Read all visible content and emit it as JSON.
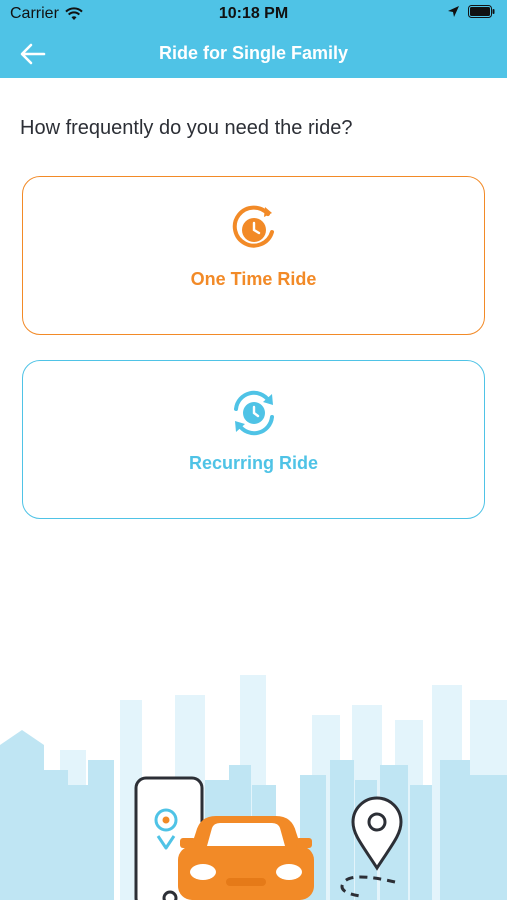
{
  "status_bar": {
    "carrier": "Carrier",
    "time": "10:18 PM",
    "icons": [
      "wifi-icon",
      "location-arrow-icon",
      "battery-icon"
    ]
  },
  "nav": {
    "title": "Ride for Single Family",
    "back_icon": "arrow-left-icon"
  },
  "question": "How frequently do you need the ride?",
  "options": [
    {
      "label": "One Time Ride",
      "icon": "clock-single-arrow-icon",
      "color": "#f28a27"
    },
    {
      "label": "Recurring Ride",
      "icon": "clock-recurring-arrows-icon",
      "color": "#4fc3e6"
    }
  ],
  "colors": {
    "primary": "#4fc3e6",
    "accent": "#f28a27",
    "text": "#2c2f36"
  }
}
